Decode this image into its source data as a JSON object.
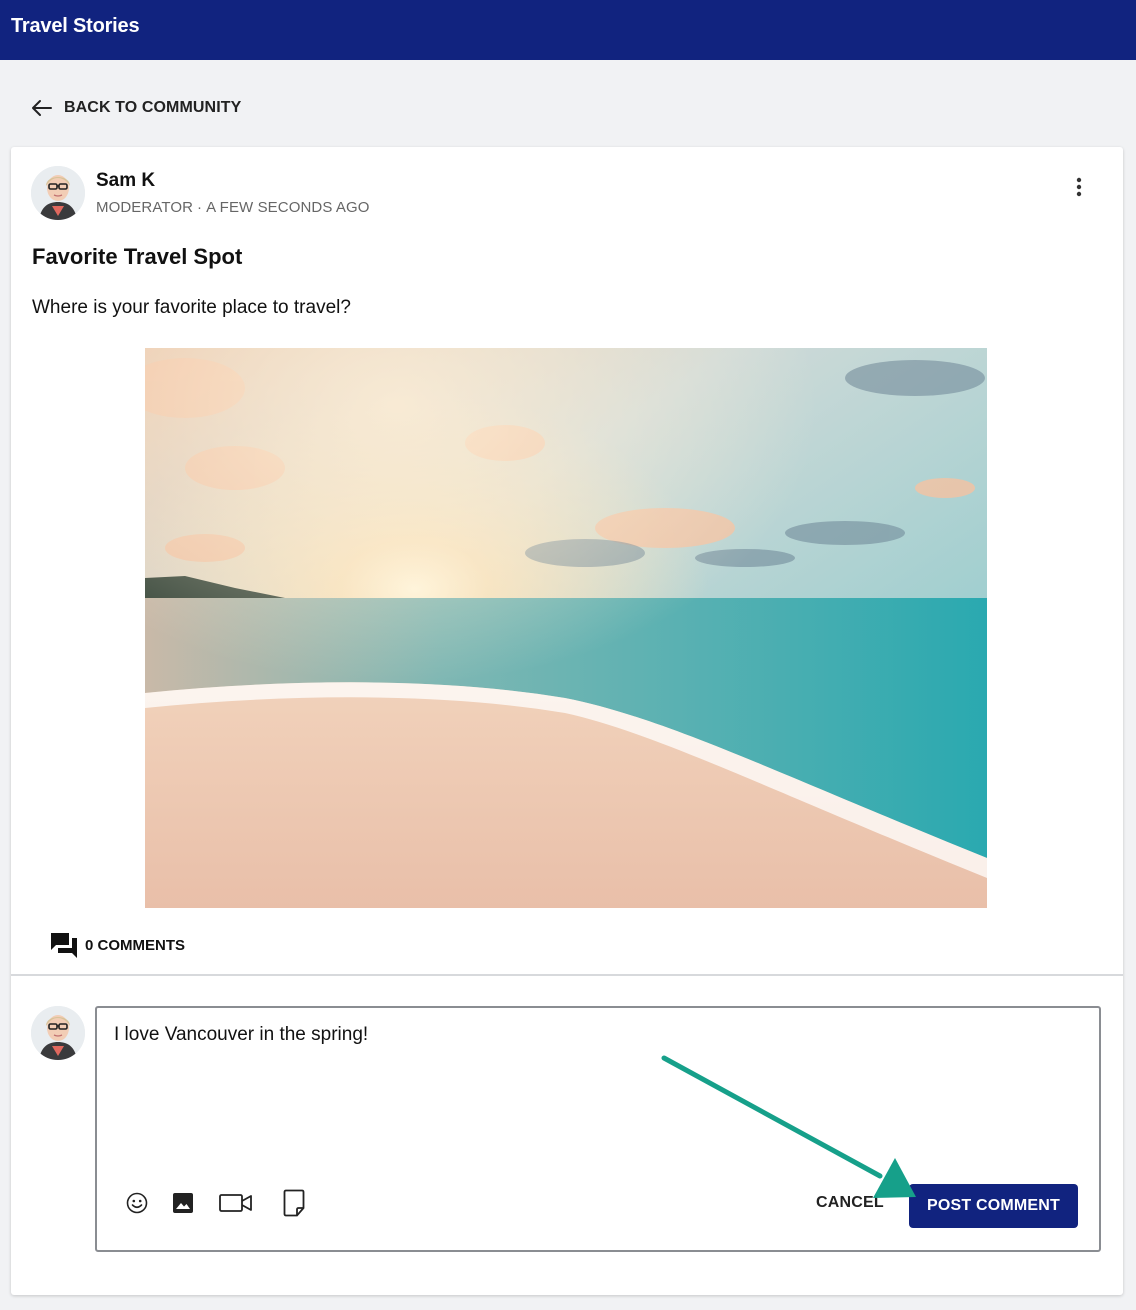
{
  "header": {
    "title": "Travel Stories"
  },
  "nav": {
    "back_label": "BACK TO COMMUNITY"
  },
  "post": {
    "author_name": "Sam K",
    "author_role": "MODERATOR",
    "separator": "·",
    "timestamp": "A FEW SECONDS AGO",
    "title": "Favorite Travel Spot",
    "body": "Where is your favorite place to travel?",
    "comments_label": "0 COMMENTS"
  },
  "composer": {
    "text": "I love Vancouver in the spring!",
    "tools": [
      "emoji-icon",
      "image-icon",
      "video-icon",
      "file-icon"
    ],
    "cancel_label": "CANCEL",
    "submit_label": "POST COMMENT"
  },
  "colors": {
    "brand": "#11237f",
    "annotation_arrow": "#16a08a"
  }
}
